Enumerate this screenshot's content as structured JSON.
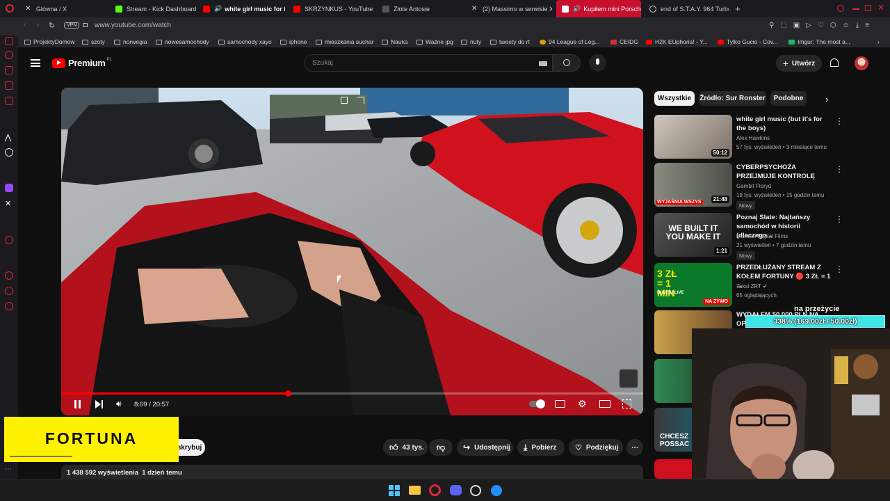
{
  "browser": {
    "tabs": [
      {
        "label": "Główna / X",
        "icon": "x-icon"
      },
      {
        "label": "Stream - Kick Dashboard",
        "icon": "kick-icon"
      },
      {
        "label": "white girl music for th",
        "icon": "youtube-icon"
      },
      {
        "label": "SKRZYNKUS - YouTube",
        "icon": "youtube-icon"
      },
      {
        "label": "Złote Antosie",
        "icon": "page-icon"
      },
      {
        "label": "(2) Massimo w serwisie X",
        "icon": "x-icon"
      },
      {
        "label": "Kupiłem mini Porsche",
        "icon": "youtube-icon"
      },
      {
        "label": "end of S.T.A.Y. 964 Turbo",
        "icon": "globe-icon"
      }
    ],
    "url": "www.youtube.com/watch",
    "vpn_label": "VPN",
    "bookmarks": [
      "ProjektyDomow",
      "szoty",
      "norwegia",
      "nowesamochody",
      "samochody xayo",
      "iphone",
      "mieszkania suchar",
      "Nauka",
      "Ważne jpg",
      "nuty",
      "tweety do rt",
      "94 League of Leg...",
      "CEIDG",
      "H2K EUphoria! - Y...",
      "Tylko Gucio - Cov...",
      "Imgur: The most a..."
    ]
  },
  "youtube": {
    "logo_text": "Premium",
    "logo_badge": "PL",
    "search_placeholder": "Szukaj",
    "create_label": "Utwórz",
    "player": {
      "time": "8:09 / 20:57",
      "progress": 0.389
    },
    "chips": [
      "Wszystkie",
      "Źródło: Sur Ronster",
      "Podobne"
    ],
    "recommendations": [
      {
        "title": "white girl music (but it's for the boys)",
        "channel": "Alex Hawkins",
        "meta": "57 tys. wyświetleń • 3 miesiące temu",
        "duration": "50:12"
      },
      {
        "title": "CYBERPSYCHOZA PRZEJMUJE KONTROLĘ",
        "channel": "Gambit Floryd",
        "meta": "19 tys. wyświetleń • 15 godzin temu",
        "duration": "21:48",
        "badge": "Nowy",
        "overlay": "WYJAŚNIA WSZYS"
      },
      {
        "title": "Poznaj Slate: Najtańszy samochód w historii (dlaczego...",
        "channel": "Marwan Digital Films",
        "meta": "21 wyświetleń • 7 godzin temu",
        "duration": "1:21",
        "badge": "Nowy",
        "overlay": "WE BUILT IT YOU MAKE IT"
      },
      {
        "title": "PRZEDŁUŻANY STREAM Z KOŁEM FORTUNY 🔴 3 ZŁ = 1 ...",
        "channel": "Taksi ZRT",
        "meta": "65 oglądających",
        "live_label": "NA ŻYWO",
        "overlay": "3 ZŁ = 1 MIN",
        "overlay2": "DŁUŻEJ LIVE"
      },
      {
        "title": "WYDAŁEM 50 000 PLN NA OP...",
        "overlay": ""
      },
      {
        "title": "",
        "overlay": ""
      },
      {
        "title": "",
        "overlay": "CHCESZ POSSAC"
      }
    ],
    "actions": {
      "subscribe_partial": "skrybuj",
      "likes": "43 tys.",
      "share": "Udostępnij",
      "download": "Pobierz",
      "thanks": "Podziękuj"
    },
    "description": "1 438 592 wyświetlenia  1 dzień temu"
  },
  "stream_overlay": {
    "sponsor": "FORTUNA",
    "goal_label": "na przeżycie",
    "goal_progress": "338% (169.00zł / 50.00zł)"
  },
  "colors": {
    "yt_red": "#ff0000",
    "fortuna_yellow": "#fff200",
    "goal_cyan": "#3ee6e6",
    "tab_active": "#c8102e"
  }
}
